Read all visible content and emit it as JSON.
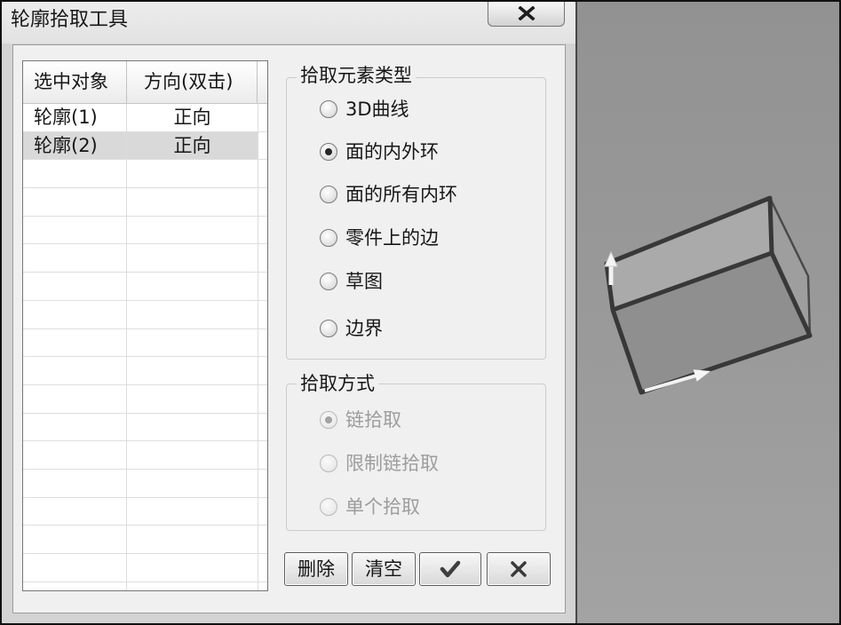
{
  "window": {
    "title": "轮廓拾取工具",
    "close_icon": "close-icon"
  },
  "table": {
    "columns": [
      "选中对象",
      "方向(双击)"
    ],
    "rows": [
      {
        "object": "轮廓(1)",
        "direction": "正向",
        "selected": false
      },
      {
        "object": "轮廓(2)",
        "direction": "正向",
        "selected": true
      }
    ]
  },
  "pick_element_type": {
    "title": "拾取元素类型",
    "options": [
      {
        "label": "3D曲线",
        "checked": false
      },
      {
        "label": "面的内外环",
        "checked": true
      },
      {
        "label": "面的所有内环",
        "checked": false
      },
      {
        "label": "零件上的边",
        "checked": false
      },
      {
        "label": "草图",
        "checked": false
      },
      {
        "label": "边界",
        "checked": false
      }
    ]
  },
  "pick_method": {
    "title": "拾取方式",
    "enabled": false,
    "options": [
      {
        "label": "链拾取",
        "checked": true
      },
      {
        "label": "限制链拾取",
        "checked": false
      },
      {
        "label": "单个拾取",
        "checked": false
      }
    ]
  },
  "buttons": {
    "delete_label": "删除",
    "clear_label": "清空",
    "ok_icon": "check-icon",
    "cancel_icon": "x-icon"
  },
  "viewport": {
    "arrow_icons": [
      "arrow-up-icon",
      "arrow-right-icon"
    ]
  },
  "colors": {
    "window_frame": "#d3d3d3",
    "title_bar": "#e2e2e2",
    "dialog_panel": "#f0f0f0",
    "selected_row": "#d9d9d9",
    "viewport_background": "#9a9a9a",
    "disabled_text": "#9d9d9d",
    "text": "#161616"
  }
}
